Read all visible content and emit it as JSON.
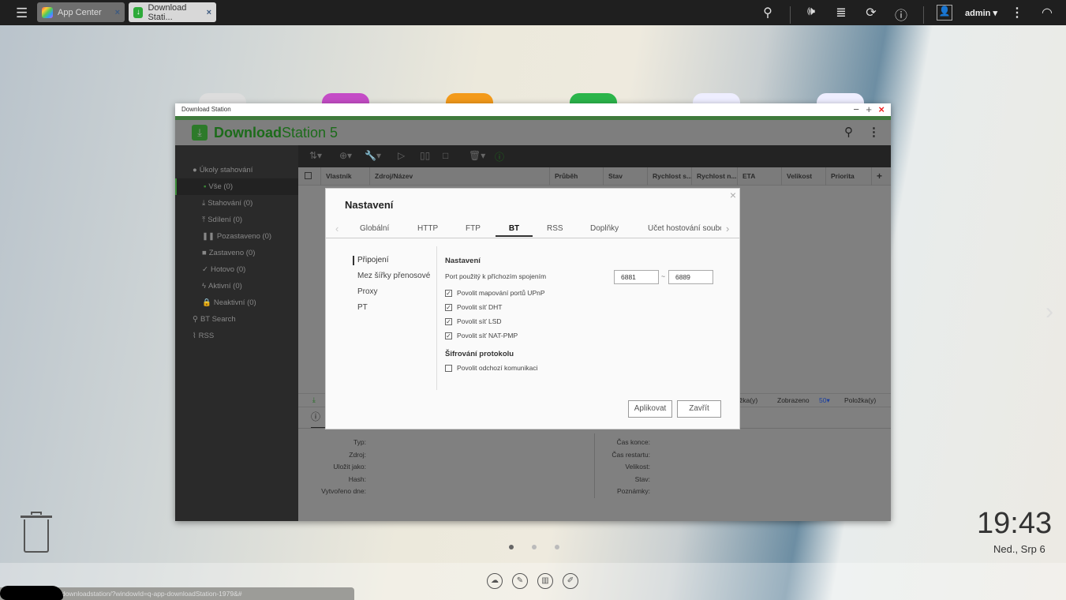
{
  "taskbar": {
    "tabs": [
      {
        "label": "App Center"
      },
      {
        "label": "Download Stati..."
      }
    ],
    "user": "admin"
  },
  "window": {
    "title": "Download Station",
    "app_name_bold": "Download",
    "app_name_rest": "Station 5"
  },
  "sidebar": {
    "section": "Úkoly stahování",
    "items": [
      {
        "label": "Vše (0)"
      },
      {
        "label": "Stahování (0)"
      },
      {
        "label": "Sdílení (0)"
      },
      {
        "label": "Pozastaveno (0)"
      },
      {
        "label": "Zastaveno (0)"
      },
      {
        "label": "Hotovo (0)"
      },
      {
        "label": "Aktivní (0)"
      },
      {
        "label": "Neaktivní (0)"
      }
    ],
    "bt_search": "BT Search",
    "rss": "RSS"
  },
  "table": {
    "columns": [
      "Vlastník",
      "Zdroj/Název",
      "Průběh",
      "Stav",
      "Rychlost s...",
      "Rychlost n...",
      "ETA",
      "Velikost",
      "Priorita"
    ],
    "add": "+"
  },
  "pager": {
    "items_label": "Položka(y)",
    "shown_label": "Zobrazeno",
    "per_page": "50",
    "items_label2": "Položka(y)"
  },
  "details": {
    "left": [
      "Typ:",
      "Zdroj:",
      "Uložit jako:",
      "Hash:",
      "Vytvořeno dne:"
    ],
    "right": [
      "Čas konce:",
      "Čas restartu:",
      "Velikost:",
      "Stav:",
      "Poznámky:"
    ]
  },
  "modal": {
    "title": "Nastavení",
    "tabs": [
      "Globální",
      "HTTP",
      "FTP",
      "BT",
      "RSS",
      "Doplňky",
      "Účet hostování soubo"
    ],
    "active_tab": "BT",
    "side": [
      "Připojení",
      "Mez šířky přenosové",
      "Proxy",
      "PT"
    ],
    "section1": "Nastavení",
    "port_label": "Port použitý k příchozím spojením",
    "port_from": "6881",
    "tilde": "~",
    "port_to": "6889",
    "checks": [
      {
        "label": "Povolit mapování portů UPnP",
        "checked": true
      },
      {
        "label": "Povolit síť DHT",
        "checked": true
      },
      {
        "label": "Povolit síť LSD",
        "checked": true
      },
      {
        "label": "Povolit síť NAT-PMP",
        "checked": true
      }
    ],
    "section2": "Šifrování protokolu",
    "check_out": {
      "label": "Povolit odchozí komunikaci",
      "checked": false
    },
    "apply": "Aplikovat",
    "close": "Zavřít"
  },
  "clock": {
    "time": "19:43",
    "date": "Ned., Srp 6"
  },
  "status_url": "downloadstation/?windowId=q-app-downloadStation-1979&#"
}
